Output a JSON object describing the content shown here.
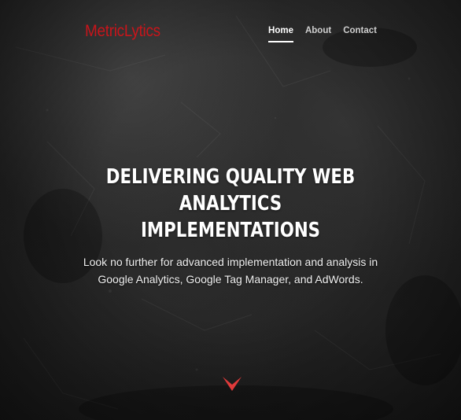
{
  "header": {
    "brand": "MetricLytics",
    "nav": [
      {
        "label": "Home",
        "active": true
      },
      {
        "label": "About",
        "active": false
      },
      {
        "label": "Contact",
        "active": false
      }
    ]
  },
  "hero": {
    "headline_line1": "DELIVERING QUALITY WEB",
    "headline_line2": "ANALYTICS IMPLEMENTATIONS",
    "subtext_line1": "Look no further for advanced implementation and analysis in",
    "subtext_line2": "Google Analytics, Google Tag Manager, and AdWords."
  },
  "icons": {
    "scroll_down": "chevron-down-icon"
  },
  "colors": {
    "brand": "#c8151b",
    "accent_arrow": "#e03a3a",
    "background": "#232323",
    "text": "#ffffff"
  }
}
